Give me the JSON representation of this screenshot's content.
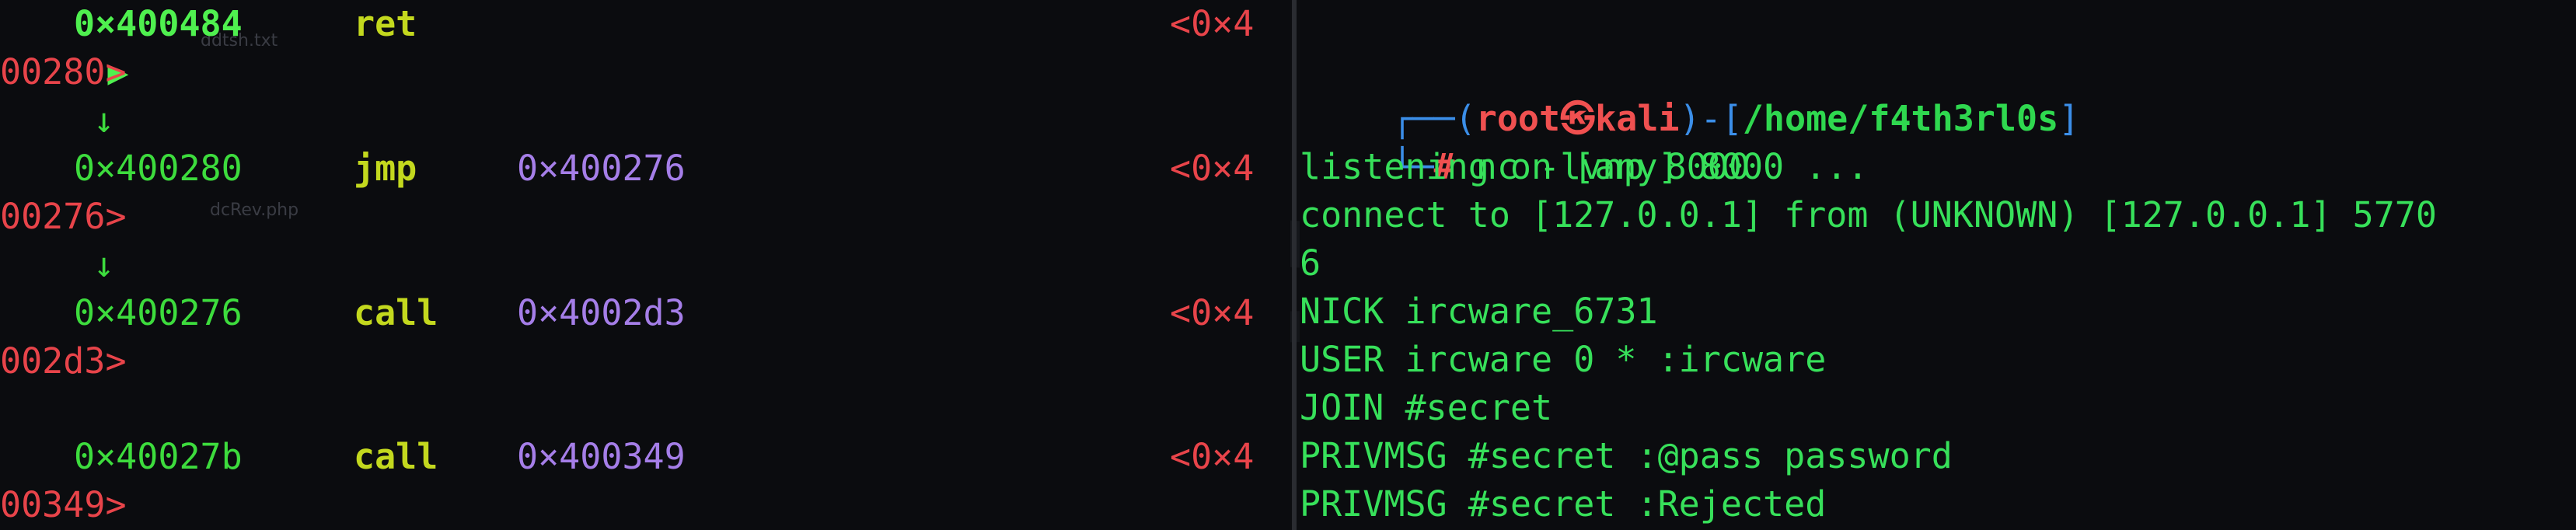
{
  "left_pane": {
    "instructions": [
      {
        "marker": "▶",
        "addr": "0×400484",
        "mnemonic": "ret",
        "operand": "",
        "tail": "<0×4",
        "wrap": "00280>"
      },
      {
        "arrow": "↓"
      },
      {
        "marker": "",
        "addr": "0×400280",
        "mnemonic": "jmp",
        "operand": "0×400276",
        "tail": "<0×4",
        "wrap": "00276>"
      },
      {
        "arrow": "↓"
      },
      {
        "marker": "",
        "addr": "0×400276",
        "mnemonic": "call",
        "operand": "0×4002d3",
        "tail": "<0×4",
        "wrap": "002d3>"
      },
      {
        "marker": "",
        "addr": "0×40027b",
        "mnemonic": "call",
        "operand": "0×400349",
        "tail": "<0×4",
        "wrap": "00349>"
      }
    ],
    "desktop_labels": {
      "file1": "ddtsh.txt",
      "file2": "dcRev.php"
    }
  },
  "right_pane": {
    "prompt": {
      "open": "┌──(",
      "user": "root",
      "at": "㉿",
      "host": "kali",
      "mid": ")-[",
      "path": "/home/f4th3rl0s",
      "close": "]",
      "second": "└─",
      "hash": "#",
      "command": "nc -lvnp 8000"
    },
    "output": [
      "listening on [any] 8000 ...",
      "connect to [127.0.0.1] from (UNKNOWN) [127.0.0.1] 5770",
      "6",
      "NICK ircware_6731",
      "USER ircware 0 * :ircware",
      "JOIN #secret",
      "PRIVMSG #secret :@pass password",
      "PRIVMSG #secret :Rejected"
    ]
  },
  "colors": {
    "background": "#0b0c0f",
    "address": "#3ddc3d",
    "mnemonic": "#c3d81e",
    "operand": "#a57ee8",
    "wrap": "#e8444a",
    "terminal_text": "#37e05a"
  }
}
